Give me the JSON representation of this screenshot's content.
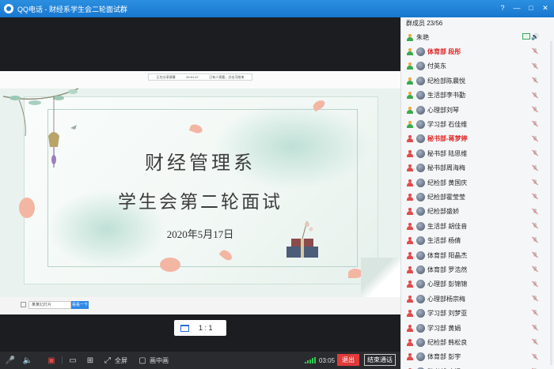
{
  "window": {
    "title": "QQ电话 - 财经系学生会二轮面试群",
    "controls": [
      "?",
      "—",
      "□",
      "✕"
    ]
  },
  "slide": {
    "share_info": [
      "正在分享屏幕",
      "00:01:47",
      "已有人观看，点击可结束"
    ],
    "title_line1": "财经管理系",
    "title_line2": "学生会第二轮面试",
    "date": "2020年5月17日",
    "page_input": "某某幻灯片",
    "page_button": "看看一下"
  },
  "view": {
    "ratio_label": "1 : 1"
  },
  "toolbar": {
    "fullscreen_label": "全屏",
    "pip_label": "画中画",
    "timer": "03:05",
    "exit_label": "退出",
    "end_label": "结束通话",
    "colors": {
      "exit": "#e13a3a",
      "signal": "#2ec94d"
    }
  },
  "members": {
    "header": "群成员 23/56",
    "items": [
      {
        "name": "朱艳",
        "highlight": false,
        "owner": true,
        "avatar": false
      },
      {
        "name": "体育部 段彤",
        "highlight": true,
        "owner": true,
        "avatar": true
      },
      {
        "name": "付英东",
        "highlight": false,
        "owner": true,
        "avatar": true
      },
      {
        "name": "纪检部陈晨悦",
        "highlight": false,
        "owner": true,
        "avatar": true
      },
      {
        "name": "生活部李书勤",
        "highlight": false,
        "owner": true,
        "avatar": true
      },
      {
        "name": "心理部刘琴",
        "highlight": false,
        "owner": true,
        "avatar": true
      },
      {
        "name": "学习部 石佳维",
        "highlight": false,
        "owner": true,
        "avatar": true
      },
      {
        "name": "秘书部-蒋梦婷",
        "highlight": true,
        "owner": false,
        "avatar": true
      },
      {
        "name": "秘书部 陆思维",
        "highlight": false,
        "owner": false,
        "avatar": true
      },
      {
        "name": "秘书部周海梅",
        "highlight": false,
        "owner": false,
        "avatar": true
      },
      {
        "name": "纪检部 黄国庆",
        "highlight": false,
        "owner": false,
        "avatar": true
      },
      {
        "name": "纪检部霍莹莹",
        "highlight": false,
        "owner": false,
        "avatar": true
      },
      {
        "name": "纪检部盛娇",
        "highlight": false,
        "owner": false,
        "avatar": true
      },
      {
        "name": "生活部 胡佳音",
        "highlight": false,
        "owner": false,
        "avatar": true
      },
      {
        "name": "生活部 杨倩",
        "highlight": false,
        "owner": false,
        "avatar": true
      },
      {
        "name": "体育部 阳晶杰",
        "highlight": false,
        "owner": false,
        "avatar": true
      },
      {
        "name": "体育部 罗浩然",
        "highlight": false,
        "owner": false,
        "avatar": true
      },
      {
        "name": "心理部 彭锦锦",
        "highlight": false,
        "owner": false,
        "avatar": true
      },
      {
        "name": "心理部杨宗梅",
        "highlight": false,
        "owner": false,
        "avatar": true
      },
      {
        "name": "学习部 刘梦亚",
        "highlight": false,
        "owner": false,
        "avatar": true
      },
      {
        "name": "学习部 黄娟",
        "highlight": false,
        "owner": false,
        "avatar": true
      },
      {
        "name": "纪检部 韩松良",
        "highlight": false,
        "owner": false,
        "avatar": true
      },
      {
        "name": "体育部 彭宇",
        "highlight": false,
        "owner": false,
        "avatar": true
      },
      {
        "name": "秘书部 唐媛",
        "highlight": false,
        "owner": false,
        "avatar": true
      }
    ]
  }
}
